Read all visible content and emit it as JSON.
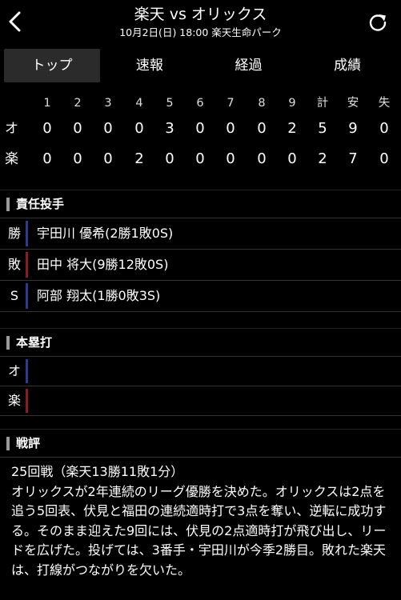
{
  "header": {
    "title": "楽天 vs オリックス",
    "subtitle": "10月2日(日) 18:00 楽天生命パーク",
    "back_icon": "chevron-left-icon",
    "reload_icon": "reload-icon"
  },
  "tabs": [
    {
      "label": "トップ",
      "active": true
    },
    {
      "label": "速報",
      "active": false
    },
    {
      "label": "経過",
      "active": false
    },
    {
      "label": "成績",
      "active": false
    }
  ],
  "scoreboard": {
    "headers": [
      "1",
      "2",
      "3",
      "4",
      "5",
      "6",
      "7",
      "8",
      "9",
      "計",
      "安",
      "失"
    ],
    "rows": [
      {
        "team": "オ",
        "values": [
          "0",
          "0",
          "0",
          "0",
          "3",
          "0",
          "0",
          "0",
          "2",
          "5",
          "9",
          "0"
        ]
      },
      {
        "team": "楽",
        "values": [
          "0",
          "0",
          "0",
          "2",
          "0",
          "0",
          "0",
          "0",
          "0",
          "2",
          "7",
          "0"
        ]
      }
    ]
  },
  "pitchers": {
    "title": "責任投手",
    "rows": [
      {
        "label": "勝",
        "name": "宇田川 優希(2勝1敗0S)",
        "color": "#2f3a8f"
      },
      {
        "label": "敗",
        "name": "田中 将大(9勝12敗0S)",
        "color": "#8b1a2b"
      },
      {
        "label": "S",
        "name": "阿部 翔太(1勝0敗3S)",
        "color": "#2f3a8f"
      }
    ]
  },
  "homeruns": {
    "title": "本塁打",
    "rows": [
      {
        "label": "オ",
        "color": "#2f3a8f"
      },
      {
        "label": "楽",
        "color": "#8b1a2b"
      }
    ]
  },
  "review": {
    "title": "戦評",
    "line1": "25回戦（楽天13勝11敗1分）",
    "body": "オリックスが2年連続のリーグ優勝を決めた。オリックスは2点を追う5回表、伏見と福田の連続適時打で3点を奪い、逆転に成功する。そのまま迎えた9回には、伏見の2点適時打が飛び出し、リードを広げた。投げては、3番手・宇田川が今季2勝目。敗れた楽天は、打線がつながりを欠いた。"
  }
}
